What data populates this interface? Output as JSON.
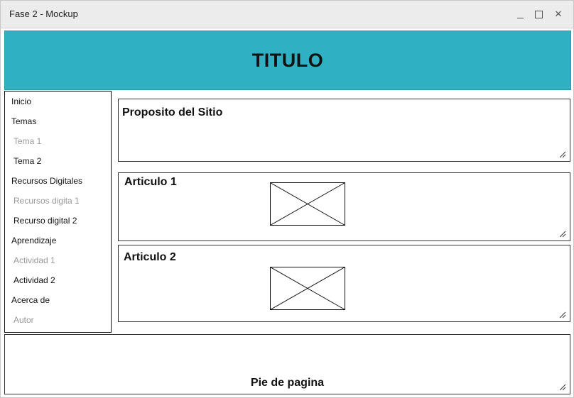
{
  "window": {
    "title": "Fase 2 - Mockup",
    "controls": [
      "minimize-icon",
      "maximize-icon",
      "close-icon"
    ],
    "close_glyph": "✕"
  },
  "header": {
    "title": "TITULO",
    "background_color": "#2fb0c3"
  },
  "sidebar": {
    "items": [
      {
        "label": "Inicio",
        "muted": false
      },
      {
        "label": "Temas",
        "muted": false
      },
      {
        "label": "Tema 1",
        "muted": true
      },
      {
        "label": "Tema 2",
        "muted": false
      },
      {
        "label": "Recursos Digitales",
        "muted": false
      },
      {
        "label": "Recursos digita 1",
        "muted": true
      },
      {
        "label": "Recurso digital 2",
        "muted": false
      },
      {
        "label": "Aprendizaje",
        "muted": false
      },
      {
        "label": "Actividad 1",
        "muted": true
      },
      {
        "label": "Actividad 2",
        "muted": false
      },
      {
        "label": "Acerca de",
        "muted": false
      },
      {
        "label": "Autor",
        "muted": true
      }
    ]
  },
  "main": {
    "purpose": {
      "title": "Proposito del Sitio"
    },
    "articles": [
      {
        "title": "Articulo 1",
        "image": "image-placeholder-icon"
      },
      {
        "title": "Articulo 2",
        "image": "image-placeholder-icon"
      }
    ]
  },
  "footer": {
    "title": "Pie de pagina"
  },
  "colors": {
    "muted_text": "#9a9a9a",
    "border": "#333333"
  }
}
